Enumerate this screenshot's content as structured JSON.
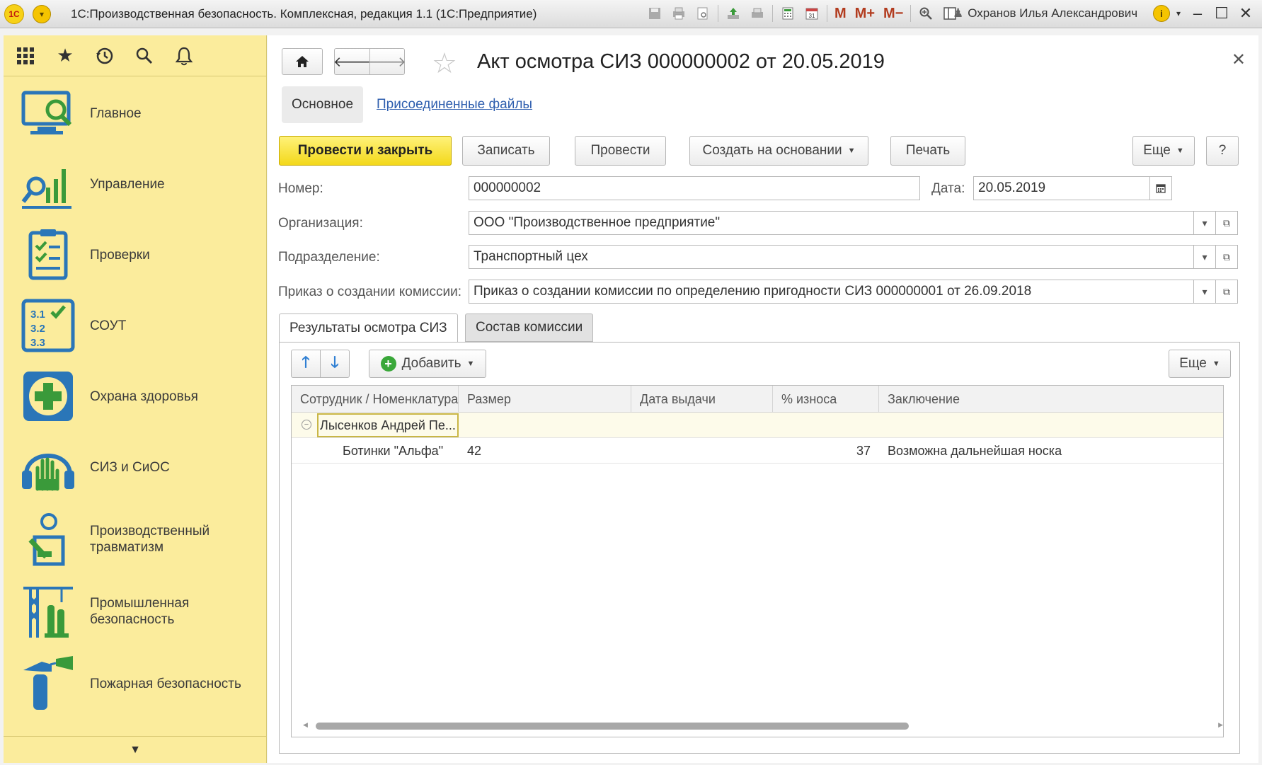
{
  "window": {
    "title": "1С:Производственная безопасность. Комплексная, редакция 1.1  (1С:Предприятие)",
    "logo_text": "1С",
    "user": "Охранов Илья Александрович",
    "toolbar_icons": [
      "save-icon",
      "print-icon",
      "preview-icon",
      "upload-icon",
      "print-preview-icon",
      "calculator-icon",
      "calendar-icon",
      "M",
      "M+",
      "M−",
      "zoom-icon",
      "panel-icon"
    ],
    "mem_labels": [
      "M",
      "M+",
      "M−"
    ]
  },
  "sidebar": {
    "top_icons": [
      "apps-grid-icon",
      "favorites-star-icon",
      "history-icon",
      "search-icon",
      "notifications-bell-icon"
    ],
    "items": [
      {
        "label": "Главное",
        "icon": "monitor-search-icon"
      },
      {
        "label": "Управление",
        "icon": "management-chart-icon"
      },
      {
        "label": "Проверки",
        "icon": "checklist-icon"
      },
      {
        "label": "СОУТ",
        "icon": "sout-list-icon"
      },
      {
        "label": "Охрана здоровья",
        "icon": "health-cross-icon"
      },
      {
        "label": "СИЗ и СиОС",
        "icon": "ppe-headphones-icon"
      },
      {
        "label": "Производственный травматизм",
        "icon": "injury-icon"
      },
      {
        "label": "Промышленная безопасность",
        "icon": "industrial-crane-icon"
      },
      {
        "label": "Пожарная безопасность",
        "icon": "fire-extinguisher-icon"
      }
    ],
    "sout_lines": [
      "3.1",
      "3.2",
      "3.3"
    ]
  },
  "document": {
    "title": "Акт осмотра СИЗ 000000002 от 20.05.2019",
    "tabs": {
      "main": "Основное",
      "files": "Присоединенные файлы"
    },
    "commands": {
      "post_close": "Провести и закрыть",
      "save": "Записать",
      "post": "Провести",
      "create_based": "Создать на основании",
      "print": "Печать",
      "more": "Еще",
      "help": "?"
    },
    "fields": {
      "number_label": "Номер:",
      "number_value": "000000002",
      "date_label": "Дата:",
      "date_value": "20.05.2019",
      "org_label": "Организация:",
      "org_value": "ООО \"Производственное предприятие\"",
      "dept_label": "Подразделение:",
      "dept_value": "Транспортный цех",
      "order_label": "Приказ о создании комиссии:",
      "order_value": "Приказ о создании комиссии по определению пригодности СИЗ 000000001 от 26.09.2018"
    },
    "subtabs": {
      "results": "Результаты осмотра СИЗ",
      "commission": "Состав комиссии"
    },
    "table_toolbar": {
      "add": "Добавить",
      "more": "Еще"
    },
    "table": {
      "columns": [
        "Сотрудник / Номенклатура",
        "Размер",
        "Дата выдачи",
        "% износа",
        "Заключение"
      ],
      "group": {
        "name": "Лысенков Андрей Пе..."
      },
      "rows": [
        {
          "item": "Ботинки \"Альфа\"",
          "size": "42",
          "issue_date": "",
          "wear": "37",
          "conclusion": "Возможна дальнейшая носка"
        }
      ]
    }
  }
}
